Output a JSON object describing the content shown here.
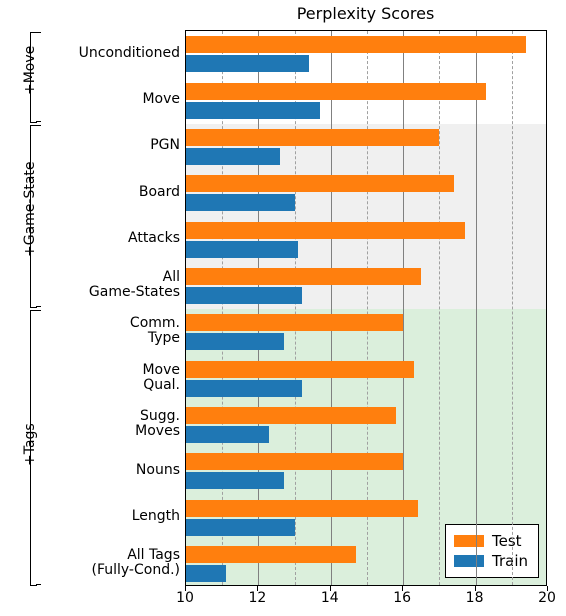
{
  "chart_data": {
    "type": "bar",
    "title": "Perplexity Scores",
    "xlim": [
      10,
      20
    ],
    "xticks_major": [
      10,
      12,
      14,
      16,
      18,
      20
    ],
    "xticks_minor": [
      11,
      13,
      15,
      17,
      19
    ],
    "categories": [
      "Unconditioned",
      "Move",
      "PGN",
      "Board",
      "Attacks",
      "All\nGame-States",
      "Comm.\nType",
      "Move\nQual.",
      "Sugg.\nMoves",
      "Nouns",
      "Length",
      "All Tags\n(Fully-Cond.)"
    ],
    "series": [
      {
        "name": "Test",
        "values": [
          19.4,
          18.3,
          17.0,
          17.4,
          17.7,
          16.5,
          16.0,
          16.3,
          15.8,
          16.0,
          16.4,
          14.7
        ]
      },
      {
        "name": "Train",
        "values": [
          13.4,
          13.7,
          12.6,
          13.0,
          13.1,
          13.2,
          12.7,
          13.2,
          12.3,
          12.7,
          13.0,
          11.1
        ]
      }
    ],
    "groups": [
      {
        "label": "+Move",
        "from": 0,
        "to": 1
      },
      {
        "label": "+Game-State",
        "from": 2,
        "to": 5
      },
      {
        "label": "+Tags",
        "from": 6,
        "to": 11
      }
    ],
    "bg_bands": [
      {
        "class": "band-gray",
        "from": 2,
        "to": 5
      },
      {
        "class": "band-green",
        "from": 6,
        "to": 11
      }
    ],
    "legend": [
      {
        "swatch": "test",
        "label": "Test"
      },
      {
        "swatch": "train",
        "label": "Train"
      }
    ]
  }
}
